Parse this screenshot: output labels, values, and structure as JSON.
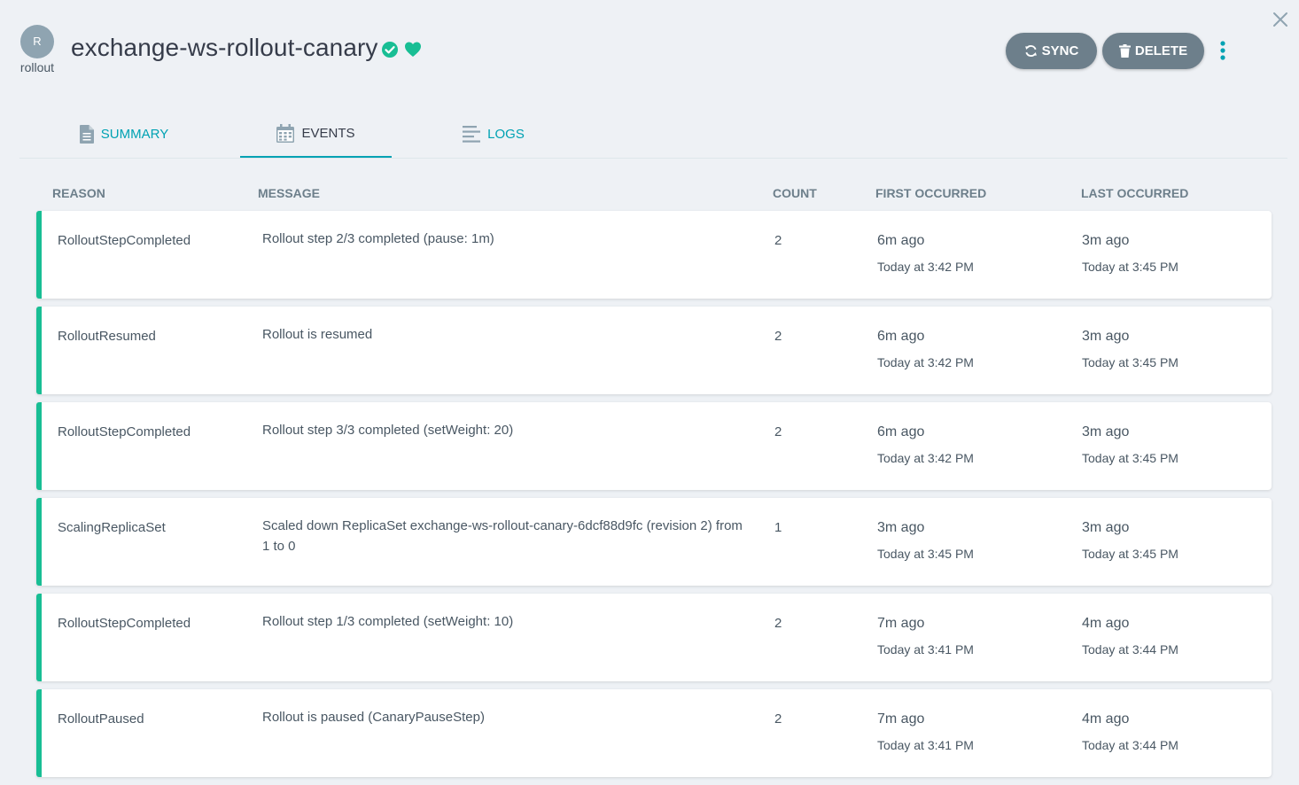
{
  "header": {
    "kind_initial": "R",
    "kind_label": "rollout",
    "title": "exchange-ws-rollout-canary",
    "sync_status_icon": "check-circle-icon",
    "health_status_icon": "heart-icon",
    "status_color": "#18be94",
    "sync_label": "SYNC",
    "delete_label": "DELETE"
  },
  "tabs": [
    {
      "label": "SUMMARY",
      "icon": "file-icon"
    },
    {
      "label": "EVENTS",
      "icon": "calendar-icon",
      "active": true
    },
    {
      "label": "LOGS",
      "icon": "lines-icon"
    }
  ],
  "events_table": {
    "columns": {
      "reason": "REASON",
      "message": "MESSAGE",
      "count": "COUNT",
      "first": "FIRST OCCURRED",
      "last": "LAST OCCURRED"
    },
    "rows": [
      {
        "reason": "RolloutStepCompleted",
        "message": "Rollout step 2/3 completed (pause: 1m)",
        "count": "2",
        "first_rel": "6m ago",
        "first_abs": "Today at 3:42 PM",
        "last_rel": "3m ago",
        "last_abs": "Today at 3:45 PM"
      },
      {
        "reason": "RolloutResumed",
        "message": "Rollout is resumed",
        "count": "2",
        "first_rel": "6m ago",
        "first_abs": "Today at 3:42 PM",
        "last_rel": "3m ago",
        "last_abs": "Today at 3:45 PM"
      },
      {
        "reason": "RolloutStepCompleted",
        "message": "Rollout step 3/3 completed (setWeight: 20)",
        "count": "2",
        "first_rel": "6m ago",
        "first_abs": "Today at 3:42 PM",
        "last_rel": "3m ago",
        "last_abs": "Today at 3:45 PM"
      },
      {
        "reason": "ScalingReplicaSet",
        "message": "Scaled down ReplicaSet exchange-ws-rollout-canary-6dcf88d9fc (revision 2) from 1 to 0",
        "count": "1",
        "first_rel": "3m ago",
        "first_abs": "Today at 3:45 PM",
        "last_rel": "3m ago",
        "last_abs": "Today at 3:45 PM"
      },
      {
        "reason": "RolloutStepCompleted",
        "message": "Rollout step 1/3 completed (setWeight: 10)",
        "count": "2",
        "first_rel": "7m ago",
        "first_abs": "Today at 3:41 PM",
        "last_rel": "4m ago",
        "last_abs": "Today at 3:44 PM"
      },
      {
        "reason": "RolloutPaused",
        "message": "Rollout is paused (CanaryPauseStep)",
        "count": "2",
        "first_rel": "7m ago",
        "first_abs": "Today at 3:41 PM",
        "last_rel": "4m ago",
        "last_abs": "Today at 3:44 PM"
      }
    ]
  }
}
